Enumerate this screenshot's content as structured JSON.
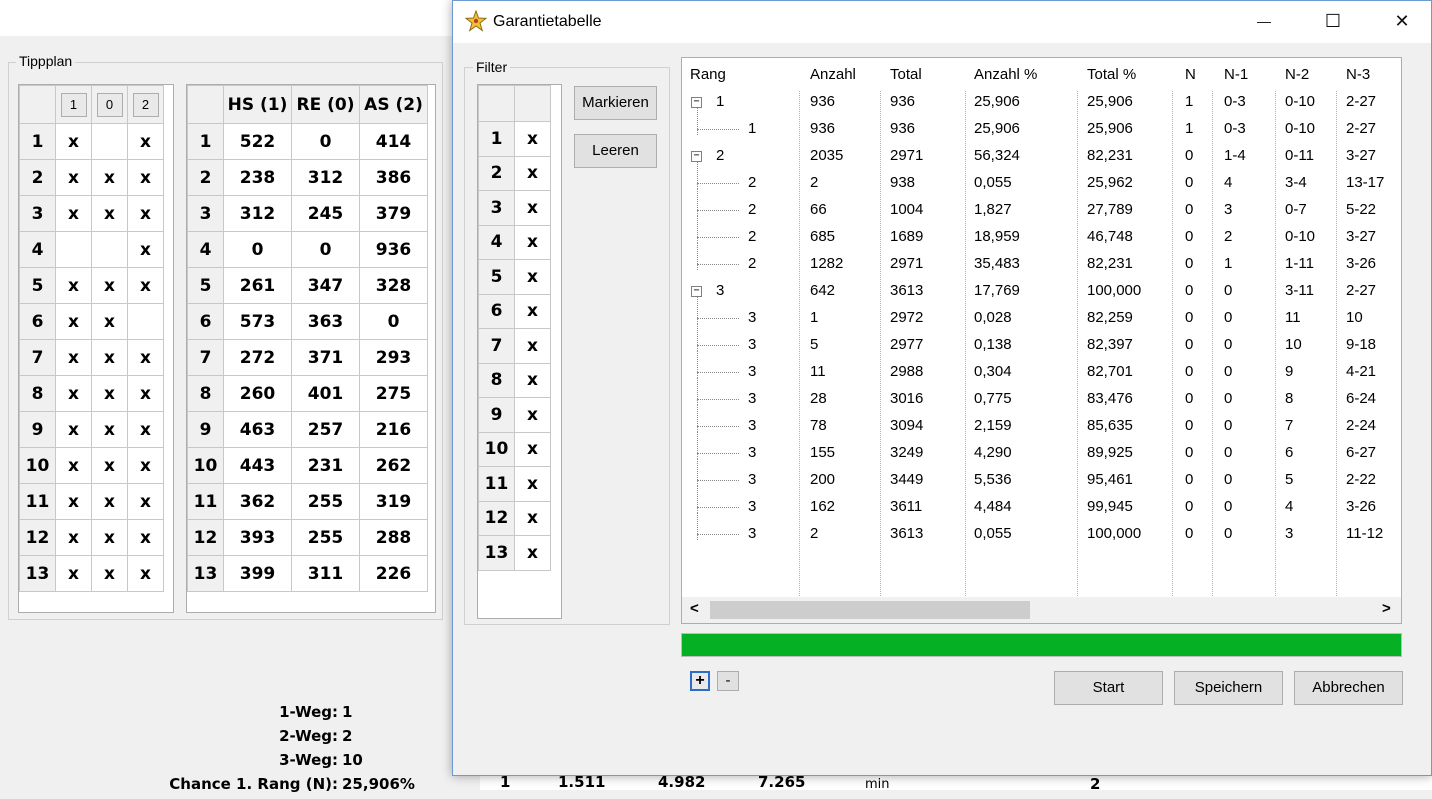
{
  "background": {
    "tippplan": {
      "title": "Tippplan",
      "header_buttons": [
        "1",
        "0",
        "2"
      ],
      "rows": [
        {
          "n": "1",
          "c1": "x",
          "c0": "",
          "c2": "x"
        },
        {
          "n": "2",
          "c1": "x",
          "c0": "x",
          "c2": "x"
        },
        {
          "n": "3",
          "c1": "x",
          "c0": "x",
          "c2": "x"
        },
        {
          "n": "4",
          "c1": "",
          "c0": "",
          "c2": "x"
        },
        {
          "n": "5",
          "c1": "x",
          "c0": "x",
          "c2": "x"
        },
        {
          "n": "6",
          "c1": "x",
          "c0": "x",
          "c2": ""
        },
        {
          "n": "7",
          "c1": "x",
          "c0": "x",
          "c2": "x"
        },
        {
          "n": "8",
          "c1": "x",
          "c0": "x",
          "c2": "x"
        },
        {
          "n": "9",
          "c1": "x",
          "c0": "x",
          "c2": "x"
        },
        {
          "n": "10",
          "c1": "x",
          "c0": "x",
          "c2": "x"
        },
        {
          "n": "11",
          "c1": "x",
          "c0": "x",
          "c2": "x"
        },
        {
          "n": "12",
          "c1": "x",
          "c0": "x",
          "c2": "x"
        },
        {
          "n": "13",
          "c1": "x",
          "c0": "x",
          "c2": "x"
        }
      ]
    },
    "stats": {
      "headers": [
        "HS (1)",
        "RE (0)",
        "AS (2)"
      ],
      "rows": [
        {
          "n": "1",
          "hs": "522",
          "re": "0",
          "as": "414"
        },
        {
          "n": "2",
          "hs": "238",
          "re": "312",
          "as": "386"
        },
        {
          "n": "3",
          "hs": "312",
          "re": "245",
          "as": "379"
        },
        {
          "n": "4",
          "hs": "0",
          "re": "0",
          "as": "936"
        },
        {
          "n": "5",
          "hs": "261",
          "re": "347",
          "as": "328"
        },
        {
          "n": "6",
          "hs": "573",
          "re": "363",
          "as": "0"
        },
        {
          "n": "7",
          "hs": "272",
          "re": "371",
          "as": "293"
        },
        {
          "n": "8",
          "hs": "260",
          "re": "401",
          "as": "275"
        },
        {
          "n": "9",
          "hs": "463",
          "re": "257",
          "as": "216"
        },
        {
          "n": "10",
          "hs": "443",
          "re": "231",
          "as": "262"
        },
        {
          "n": "11",
          "hs": "362",
          "re": "255",
          "as": "319"
        },
        {
          "n": "12",
          "hs": "393",
          "re": "255",
          "as": "288"
        },
        {
          "n": "13",
          "hs": "399",
          "re": "311",
          "as": "226"
        }
      ]
    },
    "summary": [
      {
        "label": "1-Weg:",
        "value": "1"
      },
      {
        "label": "2-Weg:",
        "value": "2"
      },
      {
        "label": "3-Weg:",
        "value": "10"
      },
      {
        "label": "Chance 1. Rang (N):",
        "value": "25,906%"
      }
    ],
    "bottom_strip": [
      "1",
      "1.511",
      "4.982",
      "7.265",
      "min",
      "2"
    ]
  },
  "dialog": {
    "title": "Garantietabelle",
    "window_buttons": {
      "minimize": "—",
      "maximize": "☐",
      "close": "✕"
    },
    "filter": {
      "title": "Filter",
      "rows": [
        {
          "n": "1",
          "v": "x"
        },
        {
          "n": "2",
          "v": "x"
        },
        {
          "n": "3",
          "v": "x"
        },
        {
          "n": "4",
          "v": "x"
        },
        {
          "n": "5",
          "v": "x"
        },
        {
          "n": "6",
          "v": "x"
        },
        {
          "n": "7",
          "v": "x"
        },
        {
          "n": "8",
          "v": "x"
        },
        {
          "n": "9",
          "v": "x"
        },
        {
          "n": "10",
          "v": "x"
        },
        {
          "n": "11",
          "v": "x"
        },
        {
          "n": "12",
          "v": "x"
        },
        {
          "n": "13",
          "v": "x"
        }
      ],
      "markieren_label": "Markieren",
      "leeren_label": "Leeren"
    },
    "tree": {
      "columns": [
        "Rang",
        "Anzahl",
        "Total",
        "Anzahl %",
        "Total %",
        "N",
        "N-1",
        "N-2",
        "N-3"
      ],
      "rows": [
        {
          "level": 0,
          "expander": "−",
          "rang": "1",
          "anzahl": "936",
          "total": "936",
          "anzahl_pct": "25,906",
          "total_pct": "25,906",
          "n": "1",
          "n1": "0-3",
          "n2": "0-10",
          "n3": "2-27"
        },
        {
          "level": 1,
          "expander": "",
          "rang": "1",
          "anzahl": "936",
          "total": "936",
          "anzahl_pct": "25,906",
          "total_pct": "25,906",
          "n": "1",
          "n1": "0-3",
          "n2": "0-10",
          "n3": "2-27"
        },
        {
          "level": 0,
          "expander": "−",
          "rang": "2",
          "anzahl": "2035",
          "total": "2971",
          "anzahl_pct": "56,324",
          "total_pct": "82,231",
          "n": "0",
          "n1": "1-4",
          "n2": "0-11",
          "n3": "3-27"
        },
        {
          "level": 1,
          "expander": "",
          "rang": "2",
          "anzahl": "2",
          "total": "938",
          "anzahl_pct": "0,055",
          "total_pct": "25,962",
          "n": "0",
          "n1": "4",
          "n2": "3-4",
          "n3": "13-17"
        },
        {
          "level": 1,
          "expander": "",
          "rang": "2",
          "anzahl": "66",
          "total": "1004",
          "anzahl_pct": "1,827",
          "total_pct": "27,789",
          "n": "0",
          "n1": "3",
          "n2": "0-7",
          "n3": "5-22"
        },
        {
          "level": 1,
          "expander": "",
          "rang": "2",
          "anzahl": "685",
          "total": "1689",
          "anzahl_pct": "18,959",
          "total_pct": "46,748",
          "n": "0",
          "n1": "2",
          "n2": "0-10",
          "n3": "3-27"
        },
        {
          "level": 1,
          "expander": "",
          "rang": "2",
          "anzahl": "1282",
          "total": "2971",
          "anzahl_pct": "35,483",
          "total_pct": "82,231",
          "n": "0",
          "n1": "1",
          "n2": "1-11",
          "n3": "3-26"
        },
        {
          "level": 0,
          "expander": "−",
          "rang": "3",
          "anzahl": "642",
          "total": "3613",
          "anzahl_pct": "17,769",
          "total_pct": "100,000",
          "n": "0",
          "n1": "0",
          "n2": "3-11",
          "n3": "2-27"
        },
        {
          "level": 1,
          "expander": "",
          "rang": "3",
          "anzahl": "1",
          "total": "2972",
          "anzahl_pct": "0,028",
          "total_pct": "82,259",
          "n": "0",
          "n1": "0",
          "n2": "11",
          "n3": "10"
        },
        {
          "level": 1,
          "expander": "",
          "rang": "3",
          "anzahl": "5",
          "total": "2977",
          "anzahl_pct": "0,138",
          "total_pct": "82,397",
          "n": "0",
          "n1": "0",
          "n2": "10",
          "n3": "9-18"
        },
        {
          "level": 1,
          "expander": "",
          "rang": "3",
          "anzahl": "11",
          "total": "2988",
          "anzahl_pct": "0,304",
          "total_pct": "82,701",
          "n": "0",
          "n1": "0",
          "n2": "9",
          "n3": "4-21"
        },
        {
          "level": 1,
          "expander": "",
          "rang": "3",
          "anzahl": "28",
          "total": "3016",
          "anzahl_pct": "0,775",
          "total_pct": "83,476",
          "n": "0",
          "n1": "0",
          "n2": "8",
          "n3": "6-24"
        },
        {
          "level": 1,
          "expander": "",
          "rang": "3",
          "anzahl": "78",
          "total": "3094",
          "anzahl_pct": "2,159",
          "total_pct": "85,635",
          "n": "0",
          "n1": "0",
          "n2": "7",
          "n3": "2-24"
        },
        {
          "level": 1,
          "expander": "",
          "rang": "3",
          "anzahl": "155",
          "total": "3249",
          "anzahl_pct": "4,290",
          "total_pct": "89,925",
          "n": "0",
          "n1": "0",
          "n2": "6",
          "n3": "6-27"
        },
        {
          "level": 1,
          "expander": "",
          "rang": "3",
          "anzahl": "200",
          "total": "3449",
          "anzahl_pct": "5,536",
          "total_pct": "95,461",
          "n": "0",
          "n1": "0",
          "n2": "5",
          "n3": "2-22"
        },
        {
          "level": 1,
          "expander": "",
          "rang": "3",
          "anzahl": "162",
          "total": "3611",
          "anzahl_pct": "4,484",
          "total_pct": "99,945",
          "n": "0",
          "n1": "0",
          "n2": "4",
          "n3": "3-26"
        },
        {
          "level": 1,
          "expander": "",
          "rang": "3",
          "anzahl": "2",
          "total": "3613",
          "anzahl_pct": "0,055",
          "total_pct": "100,000",
          "n": "0",
          "n1": "0",
          "n2": "3",
          "n3": "11-12"
        }
      ],
      "scroll_left": "<",
      "scroll_right": ">"
    },
    "progress": {
      "value": 1.0,
      "color": "#06b025"
    },
    "expand_all_label": "+",
    "collapse_all_label": "-",
    "start_label": "Start",
    "speichern_label": "Speichern",
    "abbrechen_label": "Abbrechen"
  }
}
